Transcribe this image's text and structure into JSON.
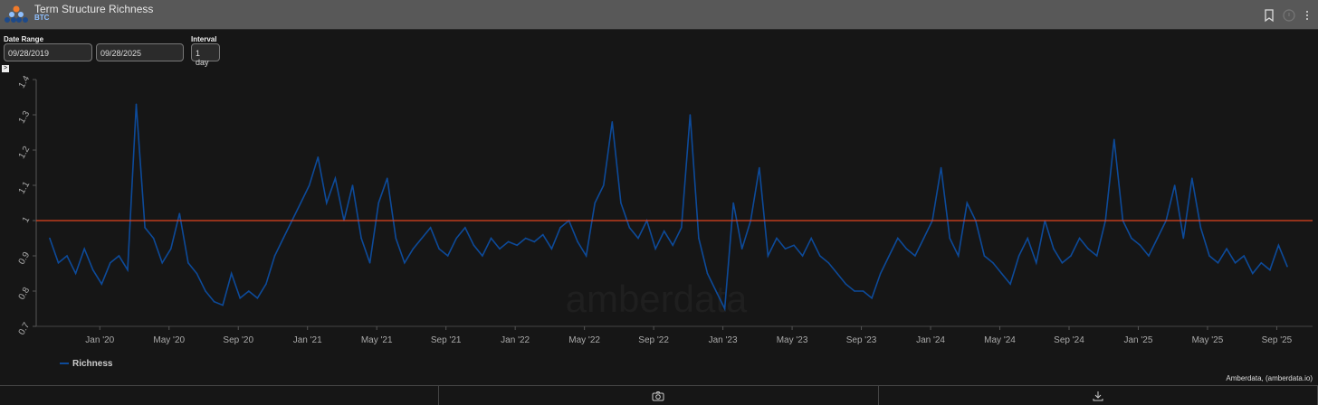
{
  "header": {
    "title": "Term Structure Richness",
    "subtitle": "BTC"
  },
  "controls": {
    "date_range_label": "Date Range",
    "start_date": "09/28/2019",
    "end_date": "09/28/2025",
    "interval_label": "Interval",
    "interval": "1 day",
    "toggle": ">"
  },
  "watermark": "amberdata",
  "credit": "Amberdata, (amberdata.io)",
  "colors": {
    "series": "#0d4a99",
    "reference": "#e0431f"
  },
  "chart_data": {
    "type": "line",
    "title": "Term Structure Richness",
    "ylim": [
      0.7,
      1.4
    ],
    "yticks": [
      "0.7",
      "0.8",
      "0.9",
      "1",
      "1.1",
      "1.2",
      "1.3",
      "1.4"
    ],
    "xticks": [
      "Jan '20",
      "May '20",
      "Sep '20",
      "Jan '21",
      "May '21",
      "Sep '21",
      "Jan '22",
      "May '22",
      "Sep '22",
      "Jan '23",
      "May '23",
      "Sep '23",
      "Jan '24",
      "May '24",
      "Sep '24",
      "Jan '25",
      "May '25",
      "Sep '25"
    ],
    "reference_line": 1.0,
    "legend": {
      "position": "bottom-left",
      "entries": [
        "Richness"
      ]
    },
    "series": [
      {
        "name": "Richness",
        "start": "2019-10",
        "points_per_month": 2,
        "values": [
          0.95,
          0.88,
          0.9,
          0.85,
          0.92,
          0.86,
          0.82,
          0.88,
          0.9,
          0.86,
          1.33,
          0.98,
          0.95,
          0.88,
          0.92,
          1.02,
          0.88,
          0.85,
          0.8,
          0.77,
          0.76,
          0.85,
          0.78,
          0.8,
          0.78,
          0.82,
          0.9,
          0.95,
          1.0,
          1.05,
          1.1,
          1.18,
          1.05,
          1.12,
          1.0,
          1.1,
          0.95,
          0.88,
          1.05,
          1.12,
          0.95,
          0.88,
          0.92,
          0.95,
          0.98,
          0.92,
          0.9,
          0.95,
          0.98,
          0.93,
          0.9,
          0.95,
          0.92,
          0.94,
          0.93,
          0.95,
          0.94,
          0.96,
          0.92,
          0.98,
          1.0,
          0.94,
          0.9,
          1.05,
          1.1,
          1.28,
          1.05,
          0.98,
          0.95,
          1.0,
          0.92,
          0.97,
          0.93,
          0.98,
          1.3,
          0.95,
          0.85,
          0.8,
          0.75,
          1.05,
          0.92,
          1.0,
          1.15,
          0.9,
          0.95,
          0.92,
          0.93,
          0.9,
          0.95,
          0.9,
          0.88,
          0.85,
          0.82,
          0.8,
          0.8,
          0.78,
          0.85,
          0.9,
          0.95,
          0.92,
          0.9,
          0.95,
          1.0,
          1.15,
          0.95,
          0.9,
          1.05,
          1.0,
          0.9,
          0.88,
          0.85,
          0.82,
          0.9,
          0.95,
          0.88,
          1.0,
          0.92,
          0.88,
          0.9,
          0.95,
          0.92,
          0.9,
          1.0,
          1.23,
          1.0,
          0.95,
          0.93,
          0.9,
          0.95,
          1.0,
          1.1,
          0.95,
          1.12,
          0.98,
          0.9,
          0.88,
          0.92,
          0.88,
          0.9,
          0.85,
          0.88,
          0.86,
          0.93,
          0.87
        ]
      }
    ]
  }
}
